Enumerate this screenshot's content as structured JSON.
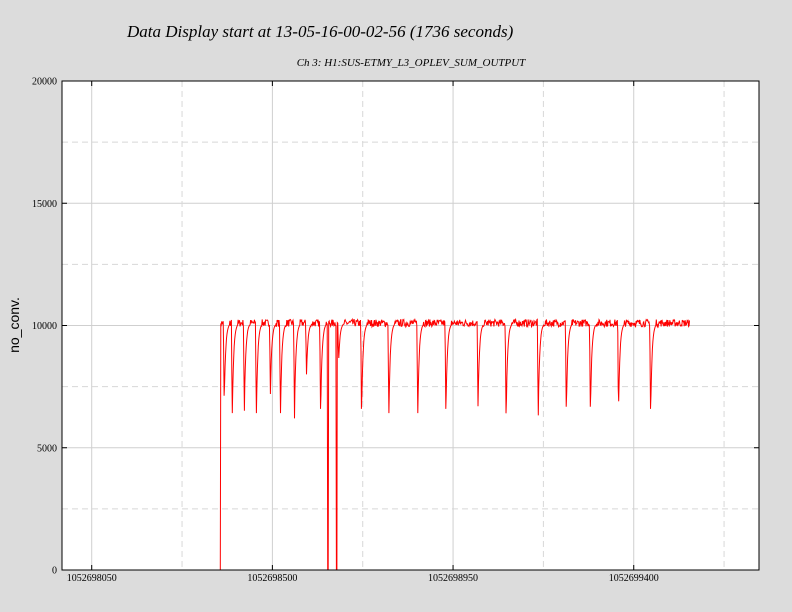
{
  "title": "Data Display start at 13-05-16-00-02-56 (1736 seconds)",
  "chart_data": {
    "type": "line",
    "subtitle": "Ch 3: H1:SUS-ETMY_L3_OPLEV_SUM_OUTPUT",
    "ylabel": "no_conv.",
    "xlabel": "",
    "xlim": [
      1052697976,
      1052699712
    ],
    "ylim": [
      0,
      20000
    ],
    "y_ticks": [
      0,
      5000,
      10000,
      15000,
      20000
    ],
    "x_ticks": [
      1052698050,
      1052698500,
      1052698950,
      1052699400
    ],
    "grid": true,
    "series": [
      {
        "color": "#ff0000",
        "signal": {
          "start": 1052698369,
          "end": 1052699540,
          "baseline": 10100,
          "ripple": 300,
          "dropouts": [
            [
              1052698369,
              0
            ],
            [
              1052698638,
              0
            ],
            [
              1052698660,
              0
            ]
          ],
          "dips": [
            [
              1052698380,
              6800
            ],
            [
              1052698400,
              6200
            ],
            [
              1052698430,
              6300
            ],
            [
              1052698460,
              6200
            ],
            [
              1052698495,
              7200
            ],
            [
              1052698520,
              6200
            ],
            [
              1052698555,
              6200
            ],
            [
              1052698585,
              8000
            ],
            [
              1052698620,
              6200
            ],
            [
              1052698665,
              8500
            ],
            [
              1052698722,
              6200
            ],
            [
              1052698790,
              6200
            ],
            [
              1052698862,
              6200
            ],
            [
              1052698932,
              6200
            ],
            [
              1052699012,
              6500
            ],
            [
              1052699082,
              6000
            ],
            [
              1052699162,
              6100
            ],
            [
              1052699232,
              6300
            ],
            [
              1052699292,
              6300
            ],
            [
              1052699362,
              6300
            ],
            [
              1052699442,
              6200
            ]
          ]
        }
      }
    ]
  }
}
